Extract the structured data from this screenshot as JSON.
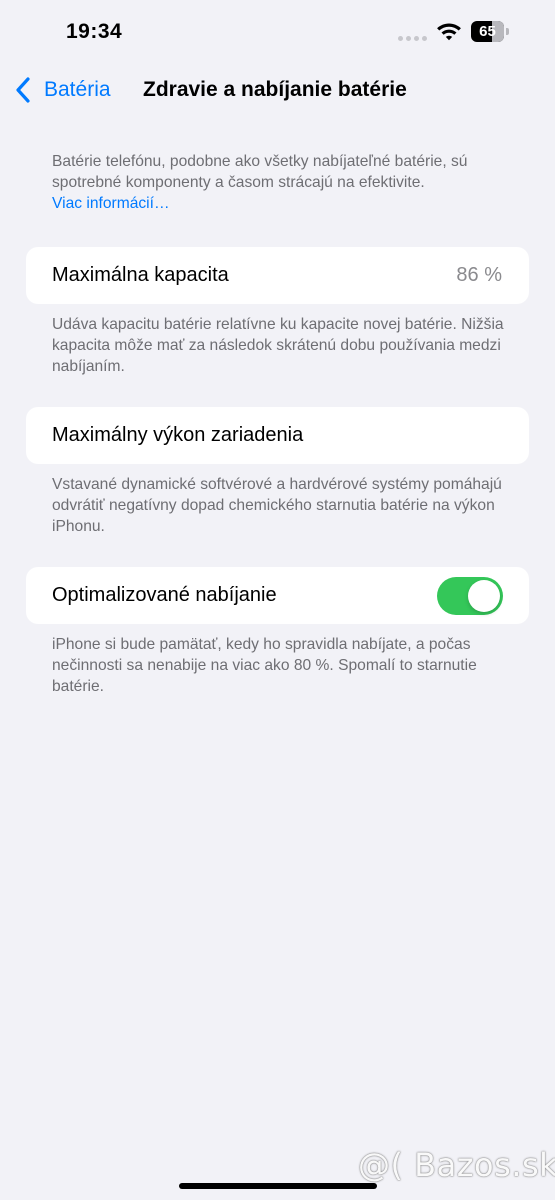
{
  "status_bar": {
    "time": "19:34",
    "battery_level": "65",
    "battery_fraction": 0.65
  },
  "nav": {
    "back_label": "Batéria",
    "title": "Zdravie a nabíjanie batérie"
  },
  "intro": {
    "text": "Batérie telefónu, podobne ako všetky nabíjateľné batérie, sú spotrebné komponenty a časom strácajú na efektivite.",
    "link": "Viac informácií…"
  },
  "max_capacity": {
    "label": "Maximálna kapacita",
    "value": "86 %",
    "footnote": "Udáva kapacitu batérie relatívne ku kapacite novej batérie. Nižšia kapacita môže mať za následok skrátenú dobu používania medzi nabíjaním."
  },
  "peak_performance": {
    "label": "Maximálny výkon zariadenia",
    "footnote": "Vstavané dynamické softvérové a hardvérové systémy pomáhajú odvrátiť negatívny dopad chemického starnutia batérie na výkon iPhonu."
  },
  "optimized_charging": {
    "label": "Optimalizované nabíjanie",
    "enabled": true,
    "footnote": "iPhone si bude pamätať, kedy ho spravidla nabíjate, a počas nečinnosti sa nenabije na viac ako 80 %. Spomalí to starnutie batérie."
  },
  "watermark": "@( Bazos.sk",
  "colors": {
    "accent": "#007aff",
    "toggle_on": "#34c759",
    "background": "#f2f2f7"
  }
}
